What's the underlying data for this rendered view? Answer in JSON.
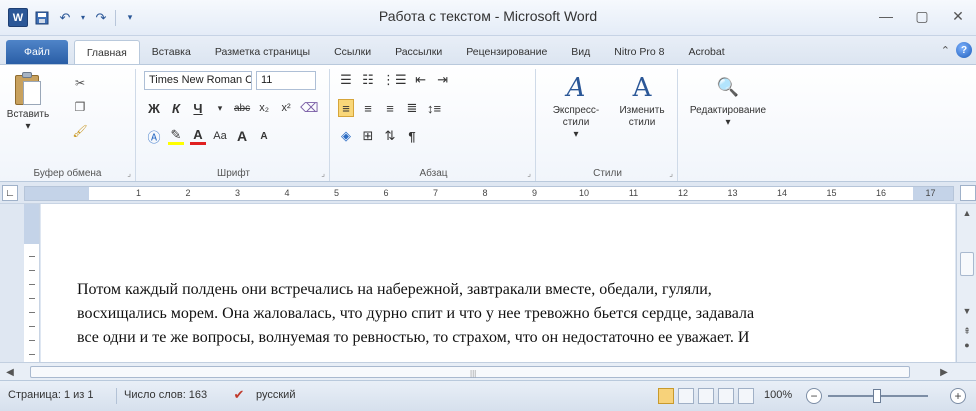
{
  "window": {
    "title": "Работа с текстом - Microsoft Word",
    "app_icon_letter": "W"
  },
  "tabs": [
    "Файл",
    "Главная",
    "Вставка",
    "Разметка страницы",
    "Ссылки",
    "Рассылки",
    "Рецензирование",
    "Вид",
    "Nitro Pro 8",
    "Acrobat"
  ],
  "active_tab": "Главная",
  "ribbon": {
    "clipboard": {
      "paste_label": "Вставить",
      "group_label": "Буфер обмена"
    },
    "font": {
      "font_name": "Times New Roman C’-",
      "font_size": "11",
      "group_label": "Шрифт",
      "grow": "A",
      "shrink": "A",
      "case": "Aa"
    },
    "paragraph": {
      "group_label": "Абзац"
    },
    "styles": {
      "quick_label": "Экспресс-стили",
      "change_label": "Изменить стили",
      "group_label": "Стили"
    },
    "editing": {
      "label": "Редактирование"
    }
  },
  "ruler_ticks": [
    "1",
    "2",
    "3",
    "4",
    "5",
    "6",
    "7",
    "8",
    "9",
    "10",
    "11",
    "12",
    "13",
    "14",
    "15",
    "16",
    "17"
  ],
  "document": {
    "lines": [
      "Потом каждый полдень они встречались на набережной, завтракали вместе, обедали, гуляли,",
      "восхищались морем. Она жаловалась, что дурно спит и что у нее тревожно бьется сердце, задавала",
      "все одни и те же вопросы, волнуемая то ревностью, то страхом, что он недостаточно ее уважает. И"
    ]
  },
  "status": {
    "page": "Страница: 1 из 1",
    "words": "Число слов: 163",
    "language": "русский",
    "zoom": "100%",
    "zoom_level_percent": 100
  }
}
